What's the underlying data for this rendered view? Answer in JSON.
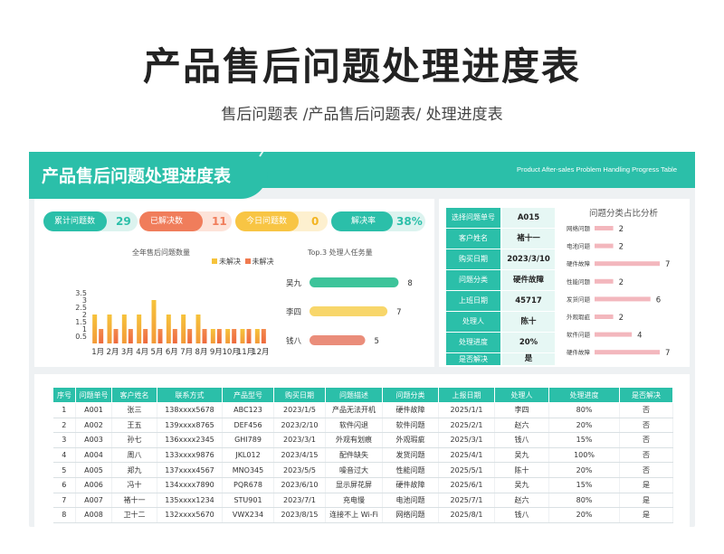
{
  "page": {
    "title": "产品售后问题处理进度表",
    "subtitle": "售后问题表 /产品售后问题表/ 处理进度表"
  },
  "banner": {
    "title": "产品售后问题处理进度表",
    "english": "Product After-sales Problem Handling Progress Table"
  },
  "stats": [
    {
      "label": "累计问题数",
      "value": "29",
      "color": "#2bbfa9"
    },
    {
      "label": "已解决数",
      "value": "11",
      "color": "#f07d5b"
    },
    {
      "label": "今日问题数",
      "value": "0",
      "color": "#f8c544"
    },
    {
      "label": "解决率",
      "value": "38%",
      "color": "#2bbfa9"
    }
  ],
  "monthly": {
    "title": "全年售后问题数量",
    "legend": [
      "未解决",
      "未解决"
    ],
    "colors": [
      "#f6c33b",
      "#f07b50"
    ]
  },
  "top3": {
    "title": "Top.3 处理人任务量",
    "names": [
      "吴九",
      "李四",
      "钱八"
    ],
    "values": [
      "8",
      "7",
      "5"
    ]
  },
  "lookup": {
    "rows": [
      {
        "key": "选择问题单号",
        "value": "A015"
      },
      {
        "key": "客户姓名",
        "value": "褚十一"
      },
      {
        "key": "购买日期",
        "value": "2023/3/10"
      },
      {
        "key": "问题分类",
        "value": "硬件故障"
      },
      {
        "key": "上班日期",
        "value": "45717"
      },
      {
        "key": "处理人",
        "value": "陈十"
      },
      {
        "key": "处理进度",
        "value": "20%"
      },
      {
        "key": "是否解决",
        "value": "是"
      }
    ]
  },
  "category": {
    "title": "问题分类占比分析",
    "labels": [
      "网络问题",
      "电池问题",
      "硬件故障",
      "性能问题",
      "发货问题",
      "外观瑕疵",
      "软件问题",
      "硬件故障"
    ],
    "values": [
      "2",
      "2",
      "7",
      "2",
      "6",
      "2",
      "4",
      "7"
    ]
  },
  "table": {
    "headers": [
      "序号",
      "问题单号",
      "客户姓名",
      "联系方式",
      "产品型号",
      "购买日期",
      "问题描述",
      "问题分类",
      "上报日期",
      "处理人",
      "处理进度",
      "是否解决"
    ],
    "rows": [
      [
        "1",
        "A001",
        "张三",
        "138xxxx5678",
        "ABC123",
        "2023/1/5",
        "产品无法开机",
        "硬件故障",
        "2025/1/1",
        "李四",
        "80%",
        "否"
      ],
      [
        "2",
        "A002",
        "王五",
        "139xxxx8765",
        "DEF456",
        "2023/2/10",
        "软件闪退",
        "软件问题",
        "2025/2/1",
        "赵六",
        "20%",
        "否"
      ],
      [
        "3",
        "A003",
        "孙七",
        "136xxxx2345",
        "GHI789",
        "2023/3/1",
        "外观有划痕",
        "外观瑕疵",
        "2025/3/1",
        "钱八",
        "15%",
        "否"
      ],
      [
        "4",
        "A004",
        "周八",
        "133xxxx9876",
        "JKL012",
        "2023/4/15",
        "配件缺失",
        "发货问题",
        "2025/4/1",
        "吴九",
        "100%",
        "否"
      ],
      [
        "5",
        "A005",
        "郑九",
        "137xxxx4567",
        "MNO345",
        "2023/5/5",
        "噪音过大",
        "性能问题",
        "2025/5/1",
        "陈十",
        "20%",
        "否"
      ],
      [
        "6",
        "A006",
        "冯十",
        "134xxxx7890",
        "PQR678",
        "2023/6/10",
        "显示屏花屏",
        "硬件故障",
        "2025/6/1",
        "吴九",
        "15%",
        "是"
      ],
      [
        "7",
        "A007",
        "褚十一",
        "135xxxx1234",
        "STU901",
        "2023/7/1",
        "充电慢",
        "电池问题",
        "2025/7/1",
        "赵六",
        "80%",
        "是"
      ],
      [
        "8",
        "A008",
        "卫十二",
        "132xxxx5670",
        "VWX234",
        "2023/8/15",
        "连接不上 Wi-Fi",
        "网络问题",
        "2025/8/1",
        "钱八",
        "20%",
        "是"
      ]
    ]
  },
  "chart_data": [
    {
      "type": "bar",
      "title": "全年售后问题数量",
      "categories": [
        "1月",
        "2月",
        "3月",
        "4月",
        "5月",
        "6月",
        "7月",
        "8月",
        "9月",
        "10月",
        "11月",
        "12月"
      ],
      "series": [
        {
          "name": "未解决",
          "values": [
            2,
            2,
            2,
            2,
            3,
            2,
            2,
            2,
            1,
            1,
            1,
            1
          ]
        },
        {
          "name": "未解决",
          "values": [
            1,
            1,
            1,
            1,
            1,
            1,
            1,
            1,
            1,
            1,
            1,
            1
          ]
        }
      ],
      "ylim": [
        0,
        3.5
      ],
      "yticks": [
        "0.5",
        "1",
        "1.5",
        "2",
        "2.5",
        "3",
        "3.5"
      ],
      "legend": "top-right"
    },
    {
      "type": "bar",
      "title": "Top.3 处理人任务量",
      "categories": [
        "吴九",
        "李四",
        "钱八"
      ],
      "values": [
        8,
        7,
        5
      ],
      "colors": [
        "#3cc49a",
        "#f8d66a",
        "#ea8d7a"
      ]
    },
    {
      "type": "bar",
      "title": "问题分类占比分析",
      "categories": [
        "网络问题",
        "电池问题",
        "硬件故障",
        "性能问题",
        "发货问题",
        "外观瑕疵",
        "软件问题",
        "硬件故障"
      ],
      "values": [
        2,
        2,
        7,
        2,
        6,
        2,
        4,
        7
      ],
      "colors": [
        "#f3b7bd"
      ]
    }
  ]
}
